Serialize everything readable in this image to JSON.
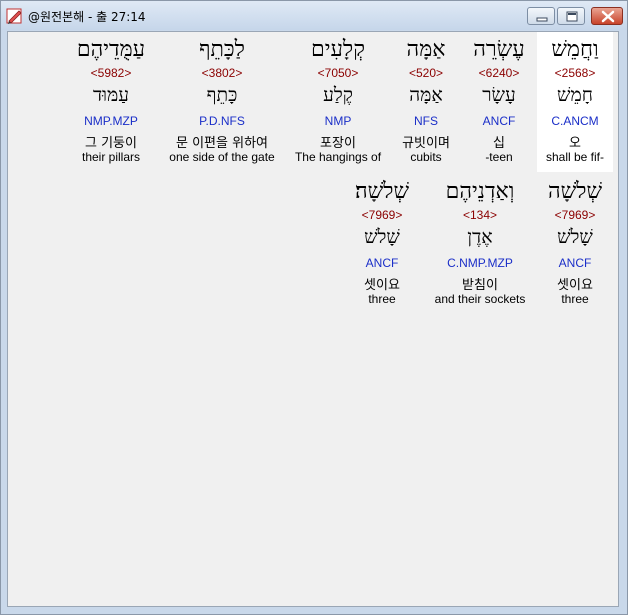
{
  "window": {
    "title": "@원전본해 - 출 27:14",
    "buttons": {
      "minimize": "minimize",
      "maximize": "maximize",
      "close": "close"
    }
  },
  "colors": {
    "strong": "#8b0000",
    "morph": "#1a2ec8",
    "client_bg": "#f0f0f0",
    "highlight_bg": "#ffffff"
  },
  "rows": [
    {
      "words": [
        {
          "hebrew": "וַחֲמֵשׁ",
          "strong": "<2568>",
          "lemma": "חָמֵשׁ",
          "morph": "C.ANCM",
          "korean": "오",
          "english": "shall be fif-",
          "highlighted": true
        },
        {
          "hebrew": "עֶשְׂרֵה",
          "strong": "<6240>",
          "lemma": "עָשָׂר",
          "morph": "ANCF",
          "korean": "십",
          "english": "-teen",
          "highlighted": false
        },
        {
          "hebrew": "אַמָּה",
          "strong": "<520>",
          "lemma": "אַמָּה",
          "morph": "NFS",
          "korean": "규빗이며",
          "english": "cubits",
          "highlighted": false
        },
        {
          "hebrew": "קְלָעִים",
          "strong": "<7050>",
          "lemma": "קֶלַע",
          "morph": "NMP",
          "korean": "포장이",
          "english": "The hangings of",
          "highlighted": false
        },
        {
          "hebrew": "לַכָּתֵף",
          "strong": "<3802>",
          "lemma": "כָּתֵף",
          "morph": "P.D.NFS",
          "korean": "문 이편을 위하여",
          "english": "one side of the gate",
          "highlighted": false
        },
        {
          "hebrew": "עַמֻּדֵיהֶם",
          "strong": "<5982>",
          "lemma": "עַמּוּד",
          "morph": "NMP.MZP",
          "korean": "그 기둥이",
          "english": "their pillars",
          "highlighted": false
        }
      ]
    },
    {
      "words": [
        {
          "hebrew": "שְׁלֹשָׁה",
          "strong": "<7969>",
          "lemma": "שָׁלֹשׁ",
          "morph": "ANCF",
          "korean": "셋이요",
          "english": "three",
          "highlighted": false
        },
        {
          "hebrew": "וְאַדְנֵיהֶם",
          "strong": "<134>",
          "lemma": "אֶדֶן",
          "morph": "C.NMP.MZP",
          "korean": "받침이",
          "english": "and their sockets",
          "highlighted": false
        },
        {
          "hebrew": "שְׁלֹשָׁה׃",
          "strong": "<7969>",
          "lemma": "שָׁלֹשׁ",
          "morph": "ANCF",
          "korean": "셋이요",
          "english": "three",
          "highlighted": false
        }
      ]
    }
  ]
}
